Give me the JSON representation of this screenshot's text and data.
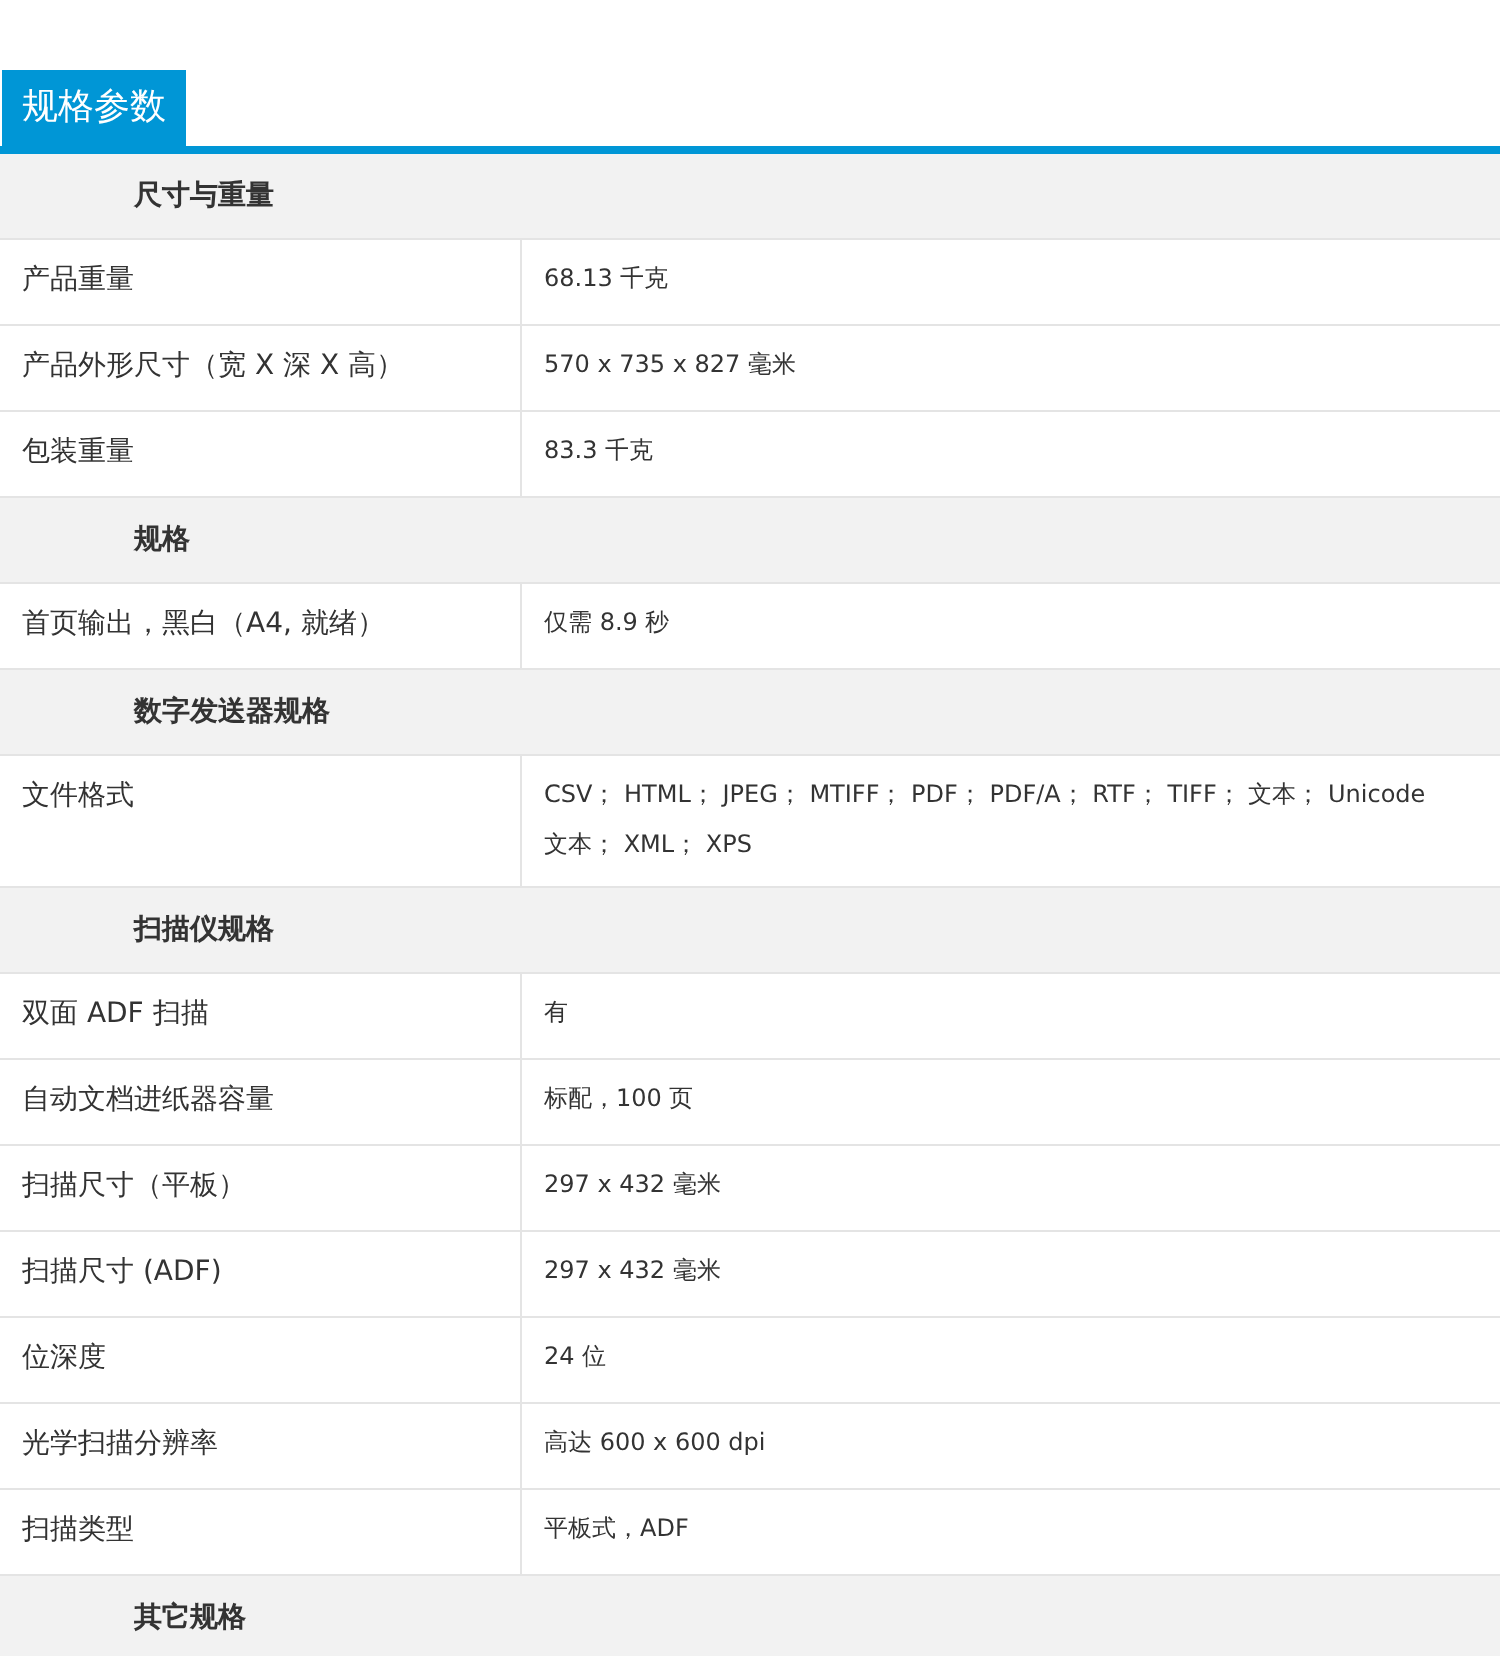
{
  "tab": {
    "label": "规格参数",
    "selected": true
  },
  "sections": [
    {
      "title": "尺寸与重量",
      "rows": [
        {
          "label": "产品重量",
          "value": "68.13 千克"
        },
        {
          "label": "产品外形尺寸（宽 X 深 X 高）",
          "value": "570 x 735 x 827 毫米"
        },
        {
          "label": "包装重量",
          "value": "83.3 千克"
        }
      ]
    },
    {
      "title": "规格",
      "rows": [
        {
          "label": "首页输出，黑白（A4, 就绪）",
          "value": "仅需 8.9 秒"
        }
      ]
    },
    {
      "title": "数字发送器规格",
      "rows": [
        {
          "label": "文件格式",
          "value": "CSV； HTML； JPEG； MTIFF； PDF； PDF/A； RTF； TIFF； 文本； Unicode 文本； XML； XPS"
        }
      ]
    },
    {
      "title": "扫描仪规格",
      "rows": [
        {
          "label": "双面 ADF 扫描",
          "value": "有"
        },
        {
          "label": "自动文档进纸器容量",
          "value": "标配，100 页"
        },
        {
          "label": "扫描尺寸（平板）",
          "value": "297 x 432 毫米"
        },
        {
          "label": "扫描尺寸 (ADF)",
          "value": "297 x 432 毫米"
        },
        {
          "label": "位深度",
          "value": "24 位"
        },
        {
          "label": "光学扫描分辨率",
          "value": "高达 600 x 600 dpi"
        },
        {
          "label": "扫描类型",
          "value": "平板式，ADF"
        }
      ]
    },
    {
      "title": "其它规格"
    }
  ]
}
